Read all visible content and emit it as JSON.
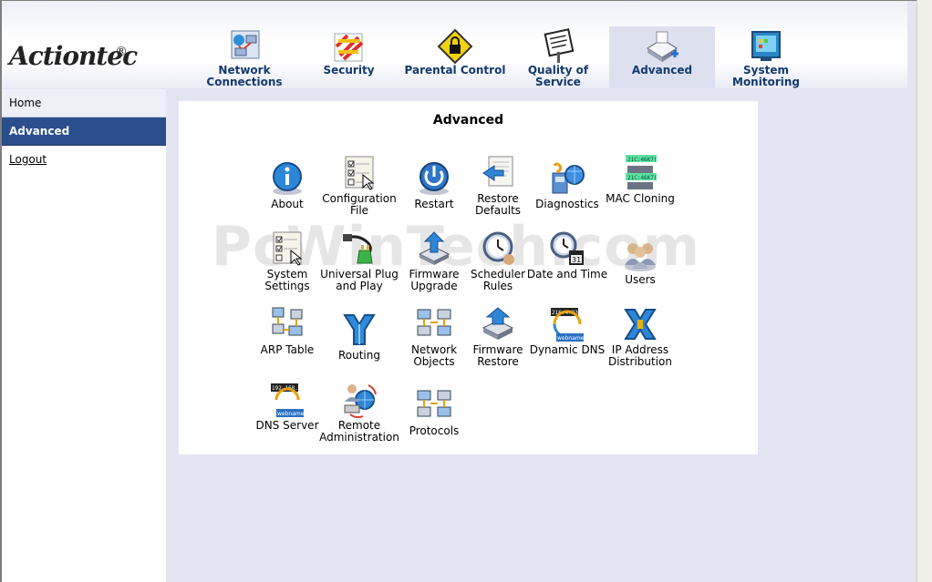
{
  "brand": {
    "logo_text": "Actiontec",
    "reg_mark": "®"
  },
  "nav": {
    "tabs": [
      {
        "label": "Network Connections",
        "icon": "network-connections-icon",
        "active": false
      },
      {
        "label": "Security",
        "icon": "security-icon",
        "active": false
      },
      {
        "label": "Parental Control",
        "icon": "parental-control-icon",
        "active": false
      },
      {
        "label": "Quality of Service",
        "icon": "quality-of-service-icon",
        "active": false
      },
      {
        "label": "Advanced",
        "icon": "advanced-icon",
        "active": true
      },
      {
        "label": "System Monitoring",
        "icon": "system-monitoring-icon",
        "active": false
      }
    ]
  },
  "sidebar": {
    "items": [
      {
        "label": "Home"
      },
      {
        "label": "Advanced"
      },
      {
        "label": "Logout"
      }
    ]
  },
  "main": {
    "title": "Advanced",
    "items": [
      {
        "label": "About",
        "icon": "info-icon"
      },
      {
        "label": "Configuration File",
        "icon": "configuration-file-icon"
      },
      {
        "label": "Restart",
        "icon": "power-icon"
      },
      {
        "label": "Restore Defaults",
        "icon": "restore-defaults-icon"
      },
      {
        "label": "Diagnostics",
        "icon": "diagnostics-icon"
      },
      {
        "label": "MAC Cloning",
        "icon": "mac-cloning-icon"
      },
      {
        "label": "System Settings",
        "icon": "system-settings-icon"
      },
      {
        "label": "Universal Plug and Play",
        "icon": "upnp-plug-icon"
      },
      {
        "label": "Firmware Upgrade",
        "icon": "firmware-upgrade-icon"
      },
      {
        "label": "Scheduler Rules",
        "icon": "scheduler-clock-icon"
      },
      {
        "label": "Date and Time",
        "icon": "date-time-icon"
      },
      {
        "label": "Users",
        "icon": "users-icon"
      },
      {
        "label": "ARP Table",
        "icon": "arp-table-icon"
      },
      {
        "label": "Routing",
        "icon": "routing-icon"
      },
      {
        "label": "Network Objects",
        "icon": "network-objects-icon"
      },
      {
        "label": "Firmware Restore",
        "icon": "firmware-restore-icon"
      },
      {
        "label": "Dynamic DNS",
        "icon": "dynamic-dns-icon"
      },
      {
        "label": "IP Address Distribution",
        "icon": "ip-distribution-icon"
      },
      {
        "label": "DNS Server",
        "icon": "dns-server-icon"
      },
      {
        "label": "Remote Administration",
        "icon": "remote-admin-icon"
      },
      {
        "label": "Protocols",
        "icon": "protocols-icon"
      }
    ]
  },
  "watermark": "PcWinTech.com"
}
